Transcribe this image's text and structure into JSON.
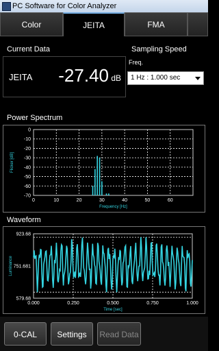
{
  "window": {
    "title": "PC Software for Color Analyzer"
  },
  "tabs": [
    {
      "label": "Color",
      "active": false
    },
    {
      "label": "JEITA",
      "active": true
    },
    {
      "label": "FMA",
      "active": false
    }
  ],
  "current_data": {
    "section_title": "Current Data",
    "label": "JEITA",
    "value": "-27.40",
    "unit": "dB"
  },
  "sampling": {
    "section_title": "Sampling Speed",
    "freq_label": "Freq.",
    "selected": "1 Hz : 1.000 sec"
  },
  "buttons": {
    "zero_cal": "0-CAL",
    "settings": "Settings",
    "read_data": "Read Data"
  },
  "colors": {
    "trace": "#34d3e0",
    "grid": "#ffffff",
    "background": "#000000"
  },
  "chart_data": [
    {
      "title": "Power Spectrum",
      "type": "bar",
      "xlabel": "Frequency [Hz]",
      "ylabel": "Flicker [dB]",
      "xlim": [
        0,
        70
      ],
      "ylim": [
        -70,
        0
      ],
      "x_ticks": [
        0,
        10,
        20,
        30,
        40,
        50,
        60
      ],
      "y_ticks": [
        0,
        -10,
        -20,
        -30,
        -40,
        -50,
        -60,
        -70
      ],
      "x": [
        26,
        27,
        28,
        29,
        30,
        32,
        33
      ],
      "values": [
        -60,
        -42,
        -28,
        -30,
        -55,
        -68,
        -68
      ]
    },
    {
      "title": "Waveform",
      "type": "line",
      "xlabel": "Time [sec]",
      "ylabel": "Luminance",
      "xlim": [
        0.0,
        1.0
      ],
      "ylim": [
        579.68,
        923.68
      ],
      "x_ticks": [
        "0.000",
        "0.250",
        "0.500",
        "0.750",
        "1.000"
      ],
      "y_ticks": [
        "923.68",
        "751.681",
        "579.68"
      ],
      "samples_per_second": 250,
      "peak_high": 905,
      "peak_low": 612,
      "base_cycles": 30
    }
  ]
}
